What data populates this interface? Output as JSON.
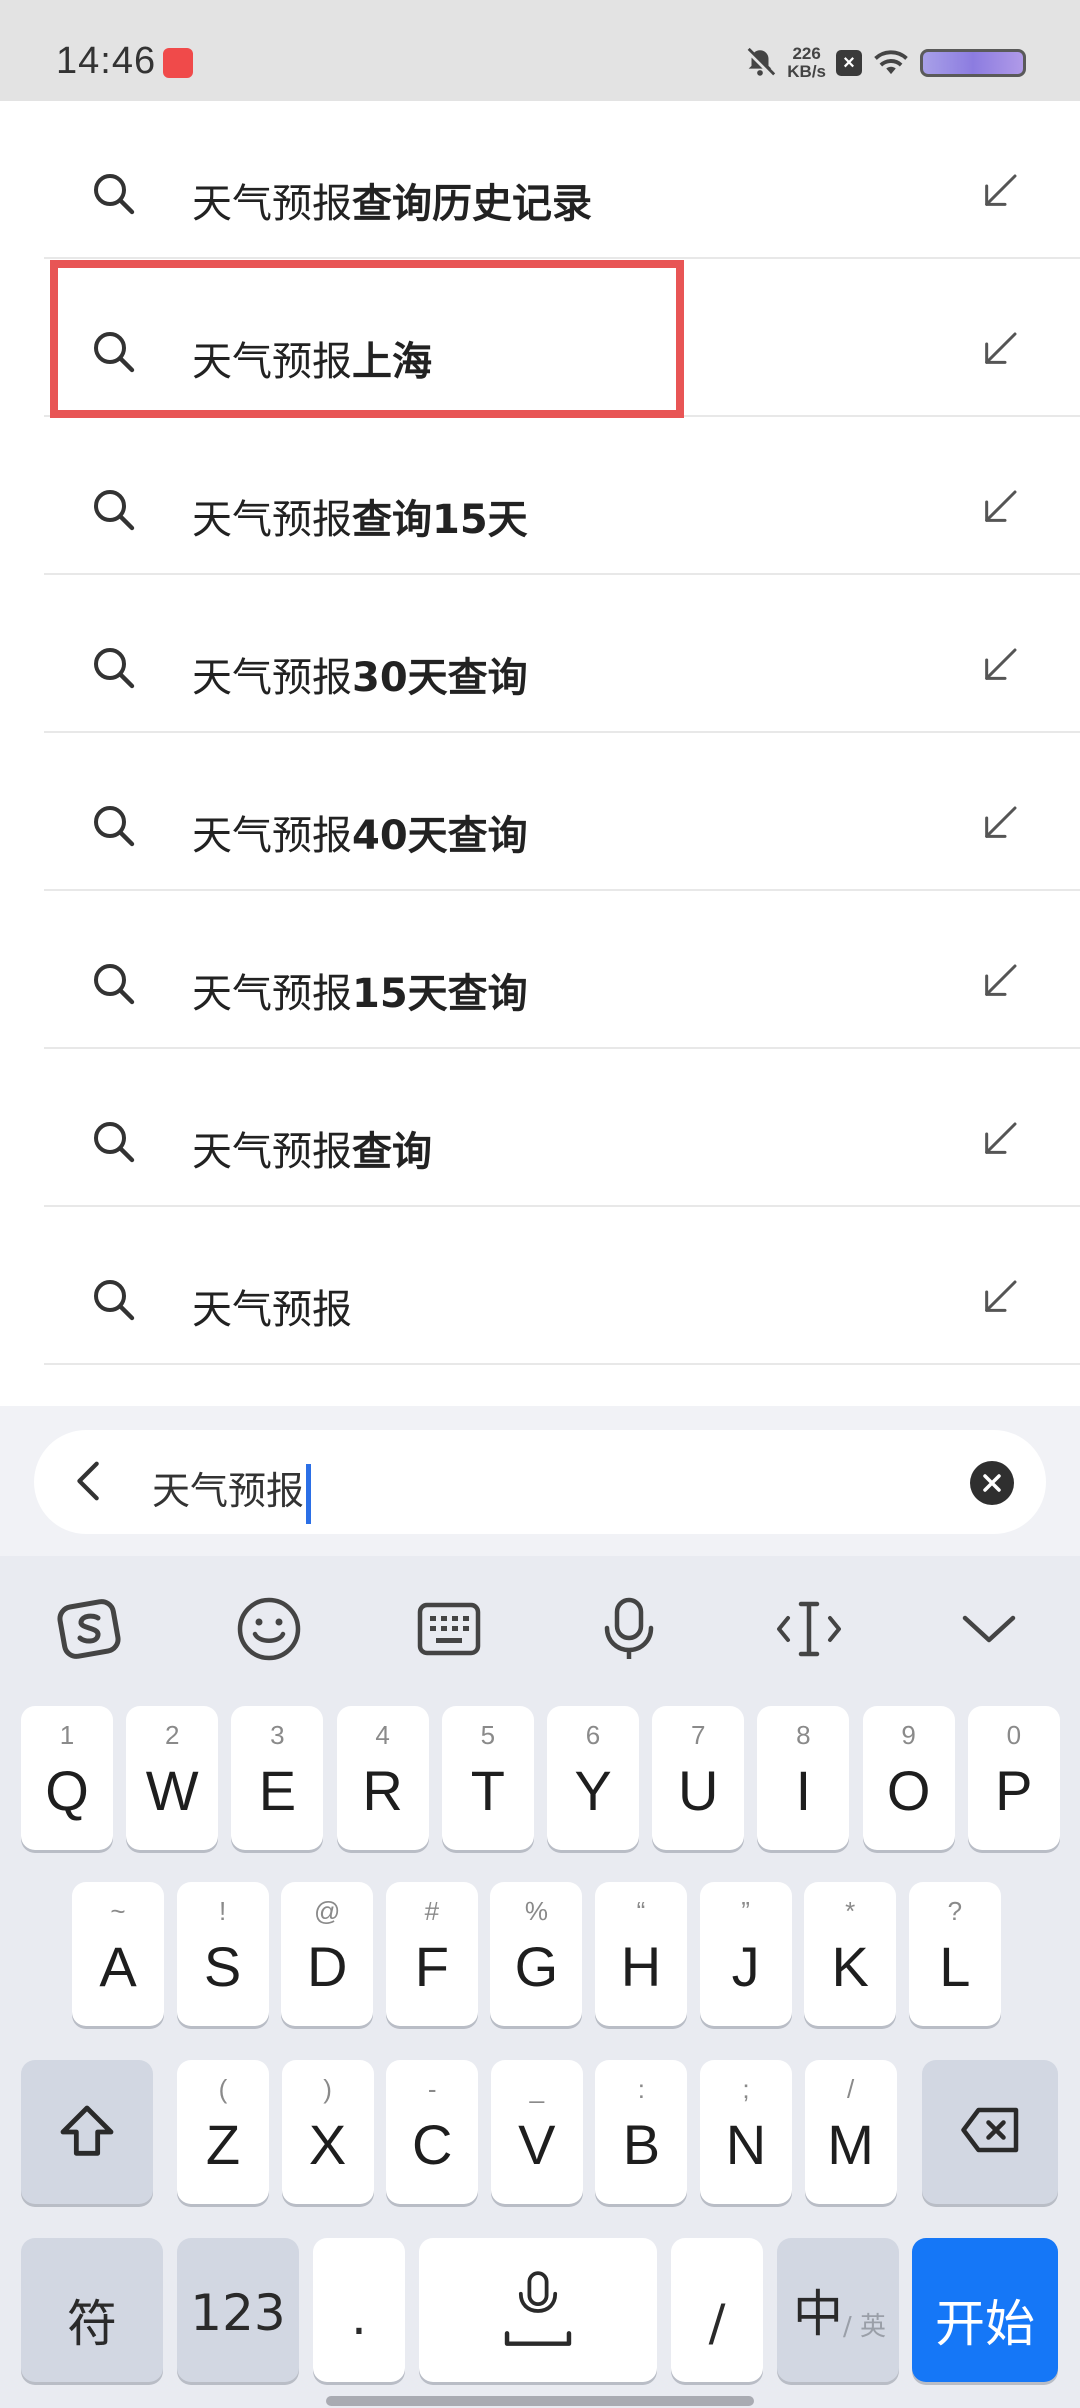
{
  "status_bar": {
    "time": "14:46",
    "net_speed_value": "226",
    "net_speed_unit": "KB/s"
  },
  "suggestions": [
    {
      "prefix": "天气预报",
      "suffix": "查询历史记录"
    },
    {
      "prefix": "天气预报",
      "suffix": "上海"
    },
    {
      "prefix": "天气预报",
      "suffix": "查询15天"
    },
    {
      "prefix": "天气预报",
      "suffix": "30天查询"
    },
    {
      "prefix": "天气预报",
      "suffix": "40天查询"
    },
    {
      "prefix": "天气预报",
      "suffix": "15天查询"
    },
    {
      "prefix": "天气预报",
      "suffix": "查询"
    },
    {
      "prefix": "天气预报",
      "suffix": ""
    }
  ],
  "search": {
    "query": "天气预报"
  },
  "keyboard": {
    "row1": [
      {
        "main": "Q",
        "sub": "1"
      },
      {
        "main": "W",
        "sub": "2"
      },
      {
        "main": "E",
        "sub": "3"
      },
      {
        "main": "R",
        "sub": "4"
      },
      {
        "main": "T",
        "sub": "5"
      },
      {
        "main": "Y",
        "sub": "6"
      },
      {
        "main": "U",
        "sub": "7"
      },
      {
        "main": "I",
        "sub": "8"
      },
      {
        "main": "O",
        "sub": "9"
      },
      {
        "main": "P",
        "sub": "0"
      }
    ],
    "row2": [
      {
        "main": "A",
        "sub": "~"
      },
      {
        "main": "S",
        "sub": "!"
      },
      {
        "main": "D",
        "sub": "@"
      },
      {
        "main": "F",
        "sub": "#"
      },
      {
        "main": "G",
        "sub": "%"
      },
      {
        "main": "H",
        "sub": "“"
      },
      {
        "main": "J",
        "sub": "”"
      },
      {
        "main": "K",
        "sub": "*"
      },
      {
        "main": "L",
        "sub": "?"
      }
    ],
    "row3": [
      {
        "main": "Z",
        "sub": "("
      },
      {
        "main": "X",
        "sub": ")"
      },
      {
        "main": "C",
        "sub": "-"
      },
      {
        "main": "V",
        "sub": "_"
      },
      {
        "main": "B",
        "sub": ":"
      },
      {
        "main": "N",
        "sub": ";"
      },
      {
        "main": "M",
        "sub": "/"
      }
    ],
    "symbols_label": "符",
    "numbers_label": "123",
    "period_label": ".",
    "slash_label": "/",
    "lang_label": "中",
    "lang_sub": "/ 英",
    "go_label": "开始"
  }
}
